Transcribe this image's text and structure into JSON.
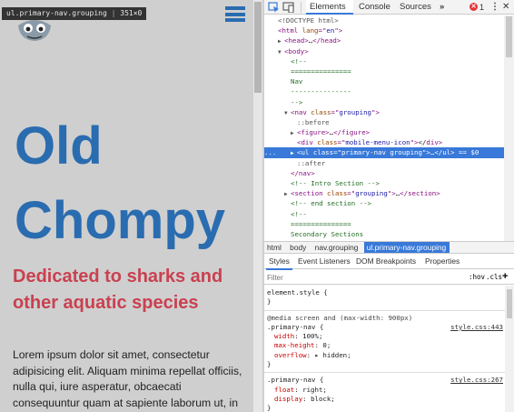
{
  "page": {
    "tooltip_selector": "ul.primary-nav.grouping",
    "tooltip_size": "351×0",
    "title_line1": "Old",
    "title_line2": "Chompy",
    "tagline": "Dedicated to sharks and other aquatic species",
    "body_text": "Lorem ipsum dolor sit amet, consectetur adipisicing elit. Aliquam minima repellat officiis, nulla qui, iure asperatur, obcaecati consequuntur quam at sapiente laborum ut, in",
    "colors": {
      "title": "#2a6cb0",
      "tagline": "#c94150",
      "background": "#cfcfcf"
    },
    "icons": {
      "hamburger": "hamburger-menu-icon",
      "mascot": "shark-mascot-icon"
    }
  },
  "devtools": {
    "toolbar": {
      "tabs": [
        "Elements",
        "Console",
        "Sources"
      ],
      "more": "»",
      "error_badge": "✕",
      "error_count": "1",
      "menu": "⋮",
      "close": "✕"
    },
    "dom_lines": [
      [
        [
          "c-pseudo",
          "<!DOCTYPE html>"
        ]
      ],
      [
        [
          "c-tag",
          "<html "
        ],
        [
          "c-attr",
          "lang"
        ],
        [
          "c-tag",
          "=\""
        ],
        [
          "c-val",
          "en"
        ],
        [
          "c-tag",
          "\">"
        ]
      ],
      [
        [
          "c-tag",
          "<head>"
        ],
        [
          "",
          "…"
        ],
        [
          "c-tag",
          "</head>"
        ]
      ],
      [
        [
          "c-tag",
          "<body>"
        ]
      ],
      [
        [
          "c-comment",
          "<!--"
        ]
      ],
      [
        [
          "c-comment",
          "==============="
        ]
      ],
      [
        [
          "c-comment",
          "Nav"
        ]
      ],
      [
        [
          "c-comment",
          "---------------"
        ]
      ],
      [
        [
          "c-comment",
          "-->"
        ]
      ],
      [
        [
          "c-tag",
          "<nav "
        ],
        [
          "c-attr",
          "class"
        ],
        [
          "c-tag",
          "=\""
        ],
        [
          "c-val",
          "grouping"
        ],
        [
          "c-tag",
          "\">"
        ]
      ],
      [
        [
          "c-pseudo",
          "::before"
        ]
      ],
      [
        [
          "c-tag",
          "<figure>"
        ],
        [
          "",
          "…"
        ],
        [
          "c-tag",
          "</figure>"
        ]
      ],
      [
        [
          "c-tag",
          "<div "
        ],
        [
          "c-attr",
          "class"
        ],
        [
          "c-tag",
          "=\""
        ],
        [
          "c-val",
          "mobile-menu-icon"
        ],
        [
          "c-tag",
          "\">"
        ],
        [
          "",
          "</"
        ],
        [
          "c-tag",
          "div>"
        ]
      ],
      [
        [
          "c-tag",
          "<ul "
        ],
        [
          "c-attr",
          "class"
        ],
        [
          "c-tag",
          "=\""
        ],
        [
          "c-val",
          "primary-nav grouping"
        ],
        [
          "c-tag",
          "\">"
        ],
        [
          "",
          "…"
        ],
        [
          "c-tag",
          "</ul>"
        ],
        [
          "",
          " == $0"
        ]
      ],
      [
        [
          "c-pseudo",
          "::after"
        ]
      ],
      [
        [
          "c-tag",
          "</nav>"
        ]
      ],
      [
        [
          "c-comment",
          "<!-- Intro Section -->"
        ]
      ],
      [
        [
          "c-tag",
          "<section "
        ],
        [
          "c-attr",
          "class"
        ],
        [
          "c-tag",
          "=\""
        ],
        [
          "c-val",
          "grouping"
        ],
        [
          "c-tag",
          "\">"
        ],
        [
          "",
          "…"
        ],
        [
          "c-tag",
          "</section>"
        ]
      ],
      [
        [
          "c-comment",
          "<!-- end section -->"
        ]
      ],
      [
        [
          "c-comment",
          "<!--"
        ]
      ],
      [
        [
          "c-comment",
          "==============="
        ]
      ],
      [
        [
          "c-comment",
          "Secondary Sections"
        ]
      ],
      [
        [
          "c-comment",
          "==============="
        ]
      ]
    ],
    "breadcrumbs": [
      "html",
      "body",
      "nav.grouping",
      "ul.primary-nav.grouping"
    ],
    "sel_gutter": "...",
    "styles_tabs": [
      "Styles",
      "Event Listeners",
      "DOM Breakpoints",
      "Properties"
    ],
    "filter_placeholder": "Filter",
    "hov_label": ":hov",
    "cls_label": ".cls",
    "add_label": "+",
    "rules": [
      {
        "selector": "element.style {",
        "source": "",
        "media": "",
        "props": [],
        "close": "}"
      },
      {
        "media": "@media screen and (max-width: 900px)",
        "selector": ".primary-nav {",
        "source": "style.css:443",
        "props": [
          [
            "width",
            "100%;"
          ],
          [
            "max-height",
            "0;"
          ],
          [
            "overflow",
            "▸ hidden;"
          ]
        ],
        "close": "}"
      },
      {
        "media": "",
        "selector": ".primary-nav {",
        "source": "style.css:267",
        "props": [
          [
            "float",
            "right;"
          ],
          [
            "display",
            "block;"
          ]
        ],
        "close": "}"
      }
    ]
  }
}
